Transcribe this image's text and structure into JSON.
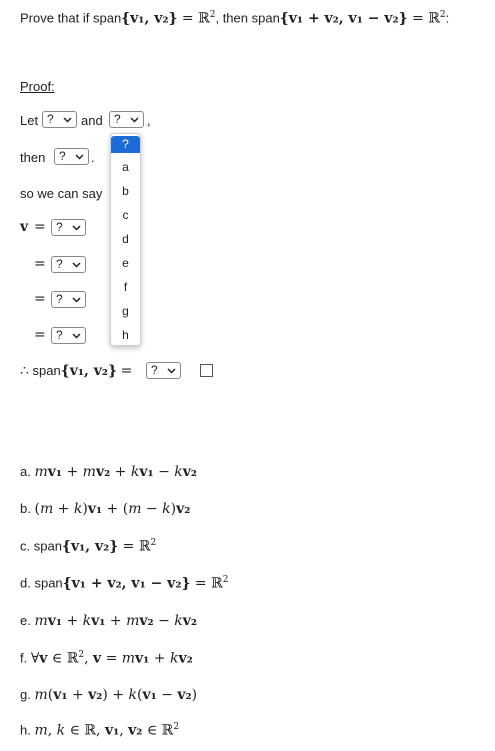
{
  "question": {
    "text_a": "Prove that if span",
    "set1": "{v₁, v₂}",
    "eq1": " = ℝ",
    "exp1": "2",
    "text_b": ", then span",
    "set2": "{v₁ + v₂, v₁ − v₂}",
    "eq2": " = ℝ",
    "exp2": "2",
    "end": ":"
  },
  "proof": {
    "heading": "Proof:",
    "let_label": "Let",
    "and_label": "and",
    "comma": ",",
    "then_label": "then",
    "period": ".",
    "so_label": "so we can say",
    "v_label": "v",
    "eq_sign": "=",
    "therefore": "∴",
    "span_label": "span",
    "span_set": "{v₁, v₂}",
    "select_placeholder": "?"
  },
  "dropdown": {
    "options": [
      "?",
      "a",
      "b",
      "c",
      "d",
      "e",
      "f",
      "g",
      "h"
    ],
    "selected_color": "#1c6bd6"
  },
  "answers": [
    {
      "label": "a.",
      "parts": [
        {
          "t": "m",
          "s": "mi"
        },
        {
          "t": "v₁",
          "s": "b"
        },
        {
          "t": " + ",
          "s": ""
        },
        {
          "t": "m",
          "s": "mi"
        },
        {
          "t": "v₂",
          "s": "b"
        },
        {
          "t": " + ",
          "s": ""
        },
        {
          "t": "k",
          "s": "mi"
        },
        {
          "t": "v₁",
          "s": "b"
        },
        {
          "t": " − ",
          "s": ""
        },
        {
          "t": "k",
          "s": "mi"
        },
        {
          "t": "v₂",
          "s": "b"
        }
      ]
    },
    {
      "label": "b.",
      "parts": [
        {
          "t": "(",
          "s": ""
        },
        {
          "t": "m",
          "s": "mi"
        },
        {
          "t": " + ",
          "s": ""
        },
        {
          "t": "k",
          "s": "mi"
        },
        {
          "t": ")",
          "s": ""
        },
        {
          "t": "v₁",
          "s": "b"
        },
        {
          "t": " + (",
          "s": ""
        },
        {
          "t": "m",
          "s": "mi"
        },
        {
          "t": " − ",
          "s": ""
        },
        {
          "t": "k",
          "s": "mi"
        },
        {
          "t": ")",
          "s": ""
        },
        {
          "t": "v₂",
          "s": "b"
        }
      ]
    },
    {
      "label": "c.",
      "parts": [
        {
          "t": "span",
          "s": "sans"
        },
        {
          "t": "{v₁, v₂}",
          "s": "b"
        },
        {
          "t": " = ℝ",
          "s": ""
        },
        {
          "t": "2",
          "s": "sup"
        }
      ]
    },
    {
      "label": "d.",
      "parts": [
        {
          "t": "span",
          "s": "sans"
        },
        {
          "t": "{v₁ + v₂, v₁ − v₂}",
          "s": "b"
        },
        {
          "t": " = ℝ",
          "s": ""
        },
        {
          "t": "2",
          "s": "sup"
        }
      ]
    },
    {
      "label": "e.",
      "parts": [
        {
          "t": "m",
          "s": "mi"
        },
        {
          "t": "v₁",
          "s": "b"
        },
        {
          "t": " + ",
          "s": ""
        },
        {
          "t": "k",
          "s": "mi"
        },
        {
          "t": "v₁",
          "s": "b"
        },
        {
          "t": " + ",
          "s": ""
        },
        {
          "t": "m",
          "s": "mi"
        },
        {
          "t": "v₂",
          "s": "b"
        },
        {
          "t": " − ",
          "s": ""
        },
        {
          "t": "k",
          "s": "mi"
        },
        {
          "t": "v₂",
          "s": "b"
        }
      ]
    },
    {
      "label": "f.",
      "parts": [
        {
          "t": "∀",
          "s": ""
        },
        {
          "t": "v",
          "s": "b"
        },
        {
          "t": " ∈ ℝ",
          "s": ""
        },
        {
          "t": "2",
          "s": "sup"
        },
        {
          "t": ", ",
          "s": ""
        },
        {
          "t": "v",
          "s": "b"
        },
        {
          "t": " = ",
          "s": ""
        },
        {
          "t": "m",
          "s": "mi"
        },
        {
          "t": "v₁",
          "s": "b"
        },
        {
          "t": " + ",
          "s": ""
        },
        {
          "t": "k",
          "s": "mi"
        },
        {
          "t": "v₂",
          "s": "b"
        }
      ]
    },
    {
      "label": "g.",
      "parts": [
        {
          "t": "m",
          "s": "mi"
        },
        {
          "t": "(",
          "s": ""
        },
        {
          "t": "v₁",
          "s": "b"
        },
        {
          "t": " + ",
          "s": ""
        },
        {
          "t": "v₂",
          "s": "b"
        },
        {
          "t": ") + ",
          "s": ""
        },
        {
          "t": "k",
          "s": "mi"
        },
        {
          "t": "(",
          "s": ""
        },
        {
          "t": "v₁",
          "s": "b"
        },
        {
          "t": " − ",
          "s": ""
        },
        {
          "t": "v₂",
          "s": "b"
        },
        {
          "t": ")",
          "s": ""
        }
      ]
    },
    {
      "label": "h.",
      "parts": [
        {
          "t": "m",
          "s": "mi"
        },
        {
          "t": ", ",
          "s": ""
        },
        {
          "t": "k",
          "s": "mi"
        },
        {
          "t": " ∈ ℝ, ",
          "s": ""
        },
        {
          "t": "v₁",
          "s": "b"
        },
        {
          "t": ", ",
          "s": ""
        },
        {
          "t": "v₂",
          "s": "b"
        },
        {
          "t": " ∈ ℝ",
          "s": ""
        },
        {
          "t": "2",
          "s": "sup"
        }
      ]
    }
  ]
}
